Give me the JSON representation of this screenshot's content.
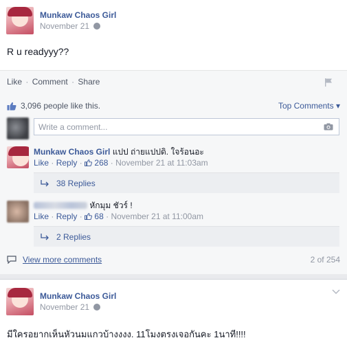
{
  "post1": {
    "author": "Munkaw Chaos Girl",
    "date": "November 21",
    "text": "R u readyyy??",
    "actions": {
      "like": "Like",
      "comment": "Comment",
      "share": "Share",
      "sep": "·"
    },
    "likes_text": "3,096 people like this.",
    "top_comments_label": "Top Comments ▾",
    "write_placeholder": "Write a comment...",
    "comments": [
      {
        "author": "Munkaw Chaos Girl",
        "text": "แปป ถ่ายแปปดิ. ใจร้อนอะ",
        "like": "Like",
        "reply": "Reply",
        "likes": "268",
        "time": "November 21 at 11:03am",
        "replies": "38 Replies"
      },
      {
        "author": "",
        "text": "หักมุม ชัวร์ !",
        "like": "Like",
        "reply": "Reply",
        "likes": "68",
        "time": "November 21 at 11:00am",
        "replies": "2 Replies"
      }
    ],
    "view_more": "View more comments",
    "page_count": "2 of 254"
  },
  "post2": {
    "author": "Munkaw Chaos Girl",
    "date": "November 21",
    "text": "มีใครอยากเห็นหัวนมแกวบ้างงงง. 11โมงตรงเจอกันคะ 1นาที!!!!"
  },
  "icons": {
    "globe": "globe-icon",
    "flag": "flag-icon",
    "thumb": "thumbs-up-icon",
    "camera": "camera-icon",
    "reply": "reply-arrow-icon",
    "chat": "comment-bubble-icon",
    "chevron": "chevron-down-icon"
  },
  "colors": {
    "link": "#3b5998",
    "muted": "#9197a3",
    "panel": "#f6f7f8"
  }
}
